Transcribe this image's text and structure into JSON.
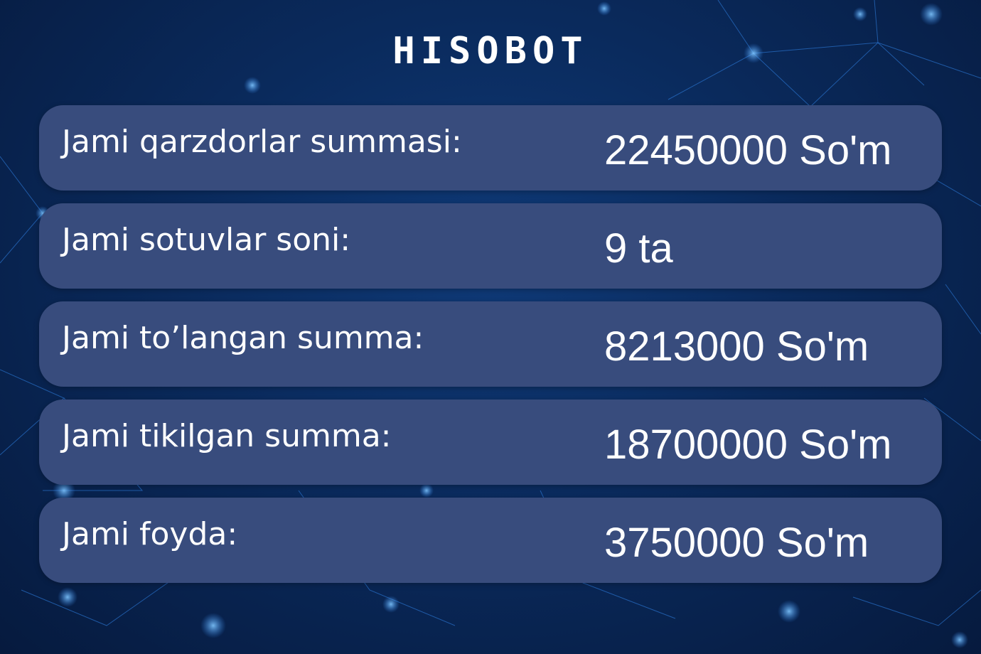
{
  "title": "HISOBOT",
  "rows": [
    {
      "label": "Jami qarzdorlar summasi:",
      "value": "22450000 So'm"
    },
    {
      "label": "Jami sotuvlar soni:",
      "value": "9 ta"
    },
    {
      "label": "Jami to’langan summa:",
      "value": "8213000 So'm"
    },
    {
      "label": "Jami tikilgan summa:",
      "value": "18700000 So'm"
    },
    {
      "label": "Jami foyda:",
      "value": "3750000 So'm"
    }
  ],
  "colors": {
    "background": "#0a2a5c",
    "row": "#384c7d",
    "text": "#ffffff",
    "network_lines": "#2f7ee0"
  }
}
